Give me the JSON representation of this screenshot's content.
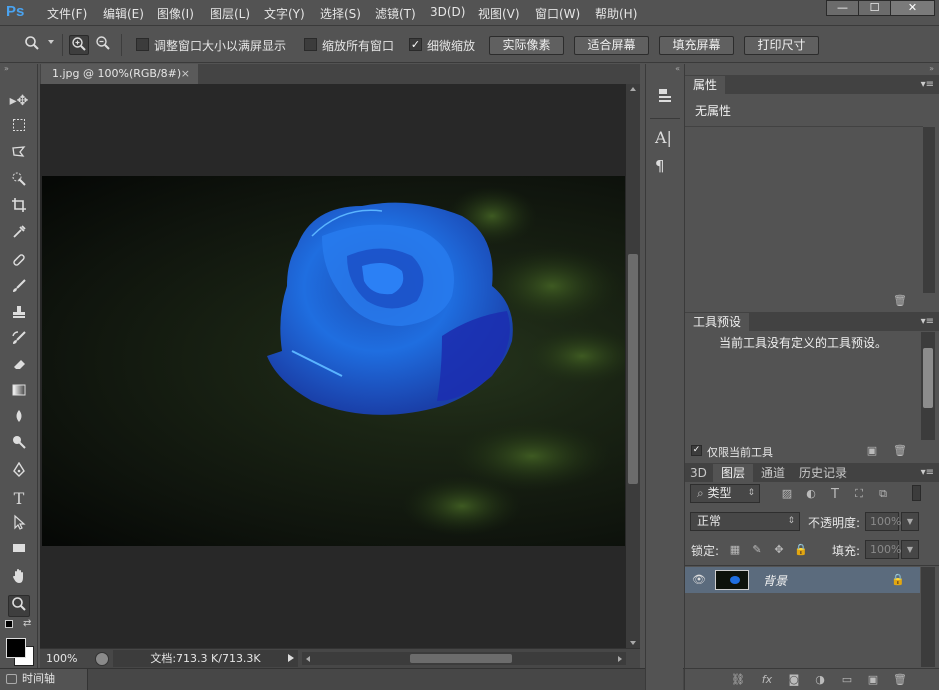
{
  "app": {
    "logo": "Ps",
    "menu": [
      "文件(F)",
      "编辑(E)",
      "图像(I)",
      "图层(L)",
      "文字(Y)",
      "选择(S)",
      "滤镜(T)",
      "3D(D)",
      "视图(V)",
      "窗口(W)",
      "帮助(H)"
    ],
    "window_buttons": {
      "minimize": "—",
      "maximize": "☐",
      "close": "✕"
    }
  },
  "options_bar": {
    "checks": [
      {
        "label": "调整窗口大小以满屏显示",
        "checked": false
      },
      {
        "label": "缩放所有窗口",
        "checked": false
      },
      {
        "label": "细微缩放",
        "checked": true
      }
    ],
    "buttons": [
      "实际像素",
      "适合屏幕",
      "填充屏幕",
      "打印尺寸"
    ]
  },
  "document": {
    "tab_title": "1.jpg @ 100%(RGB/8#)",
    "tab_close": "×",
    "zoom": "100%",
    "doc_info": "文档:713.3 K/713.3K"
  },
  "timeline": {
    "label": "时间轴"
  },
  "properties_panel": {
    "tab": "属性",
    "content": "无属性"
  },
  "tool_presets_panel": {
    "tab": "工具预设",
    "content": "当前工具没有定义的工具预设。",
    "current_tool_only": "仅限当前工具"
  },
  "layers_panel": {
    "tabs": [
      "3D",
      "图层",
      "通道",
      "历史记录"
    ],
    "active_tab": "图层",
    "filter_kind": "类型",
    "blend_mode": "正常",
    "opacity_label": "不透明度:",
    "opacity_value": "100%",
    "lock_label": "锁定:",
    "fill_label": "填充:",
    "fill_value": "100%",
    "layers": [
      {
        "name": "背景",
        "visible": true,
        "locked": true
      }
    ]
  },
  "colors": {
    "accent": "#4aa3f0",
    "canvas_bg": "#282828",
    "panel_bg": "#535353",
    "layer_selected": "#5b6b7d"
  }
}
